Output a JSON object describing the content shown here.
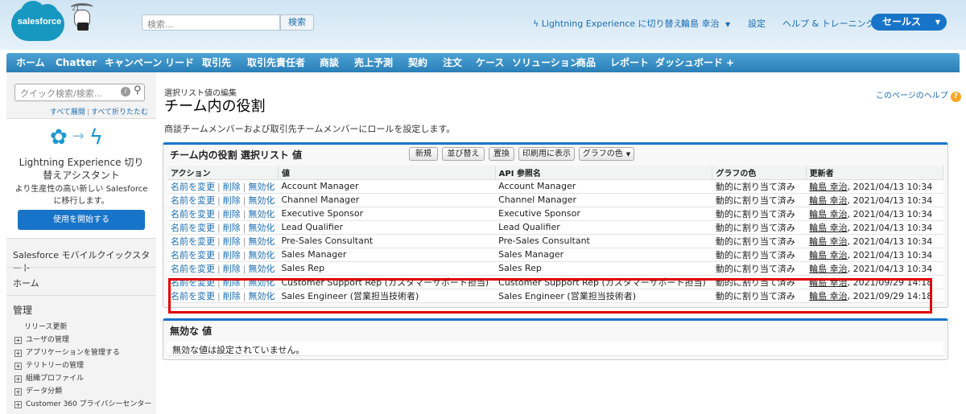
{
  "header": {
    "logo_text": "salesforce",
    "mascot_year": "'21",
    "search_placeholder": "検索...",
    "search_button": "検索",
    "lightning_link": "Lightning Experience に切り替え",
    "user_name": "輪島 幸治",
    "setup": "設定",
    "help_training": "ヘルプ & トレーニング",
    "app_name": "セールス"
  },
  "tabs": [
    "ホーム",
    "Chatter",
    "キャンペーン",
    "リード",
    "取引先",
    "取引先責任者",
    "商談",
    "売上予測",
    "契約",
    "注文",
    "ケース",
    "ソリューション",
    "商品",
    "レポート",
    "ダッシュボード",
    "+"
  ],
  "sidebar": {
    "quick_search_placeholder": "クイック検索/検索...",
    "expand_all": "すべて展開",
    "collapse_all": "すべて折りたたむ",
    "card_title": "Lightning Experience 切り替えアシスタント",
    "card_desc": "より生産性の高い新しい Salesforce に移行します。",
    "card_button": "使用を開始する",
    "mobile_quickstart": "Salesforce モバイルクイックスタート",
    "home": "ホーム",
    "admin": "管理",
    "release_update": "リリース更新",
    "items": [
      "ユーザの管理",
      "アプリケーションを管理する",
      "テリトリーの管理",
      "組織プロファイル",
      "データ分類",
      "Customer 360 プライバシーセンター"
    ]
  },
  "main": {
    "breadcrumb": "選択リスト値の編集",
    "title": "チーム内の役割",
    "help_link": "このページのヘルプ",
    "description": "商談チームメンバーおよび取引先チームメンバーにロールを設定します。",
    "list_title": "チーム内の役割 選択リスト 値",
    "buttons": {
      "new": "新規",
      "reorder": "並び替え",
      "replace": "置換",
      "printable": "印刷用に表示",
      "chart_color": "グラフの色"
    },
    "columns": [
      "アクション",
      "値",
      "API 参照名",
      "グラフの色",
      "更新者"
    ],
    "actions": {
      "rename": "名前を変更",
      "delete": "削除",
      "deactivate": "無効化"
    },
    "rows": [
      {
        "value": "Account Manager",
        "api": "Account Manager",
        "color": "動的に割り当て済み",
        "user": "輪島 幸治",
        "date": ", 2021/04/13 10:34"
      },
      {
        "value": "Channel Manager",
        "api": "Channel Manager",
        "color": "動的に割り当て済み",
        "user": "輪島 幸治",
        "date": ", 2021/04/13 10:34"
      },
      {
        "value": "Executive Sponsor",
        "api": "Executive Sponsor",
        "color": "動的に割り当て済み",
        "user": "輪島 幸治",
        "date": ", 2021/04/13 10:34"
      },
      {
        "value": "Lead Qualifier",
        "api": "Lead Qualifier",
        "color": "動的に割り当て済み",
        "user": "輪島 幸治",
        "date": ", 2021/04/13 10:34"
      },
      {
        "value": "Pre-Sales Consultant",
        "api": "Pre-Sales Consultant",
        "color": "動的に割り当て済み",
        "user": "輪島 幸治",
        "date": ", 2021/04/13 10:34"
      },
      {
        "value": "Sales Manager",
        "api": "Sales Manager",
        "color": "動的に割り当て済み",
        "user": "輪島 幸治",
        "date": ", 2021/04/13 10:34"
      },
      {
        "value": "Sales Rep",
        "api": "Sales Rep",
        "color": "動的に割り当て済み",
        "user": "輪島 幸治",
        "date": ", 2021/04/13 10:34"
      },
      {
        "value": "Customer Support Rep (カスタマーサポート担当)",
        "api": "Customer Support Rep (カスタマーサポート担当)",
        "color": "動的に割り当て済み",
        "user": "輪島 幸治",
        "date": ", 2021/09/29 14:18"
      },
      {
        "value": "Sales Engineer (営業担当技術者)",
        "api": "Sales Engineer (営業担当技術者)",
        "color": "動的に割り当て済み",
        "user": "輪島 幸治",
        "date": ", 2021/09/29 14:18"
      }
    ],
    "inactive_title": "無効な 値",
    "inactive_msg": "無効な値は設定されていません。"
  }
}
